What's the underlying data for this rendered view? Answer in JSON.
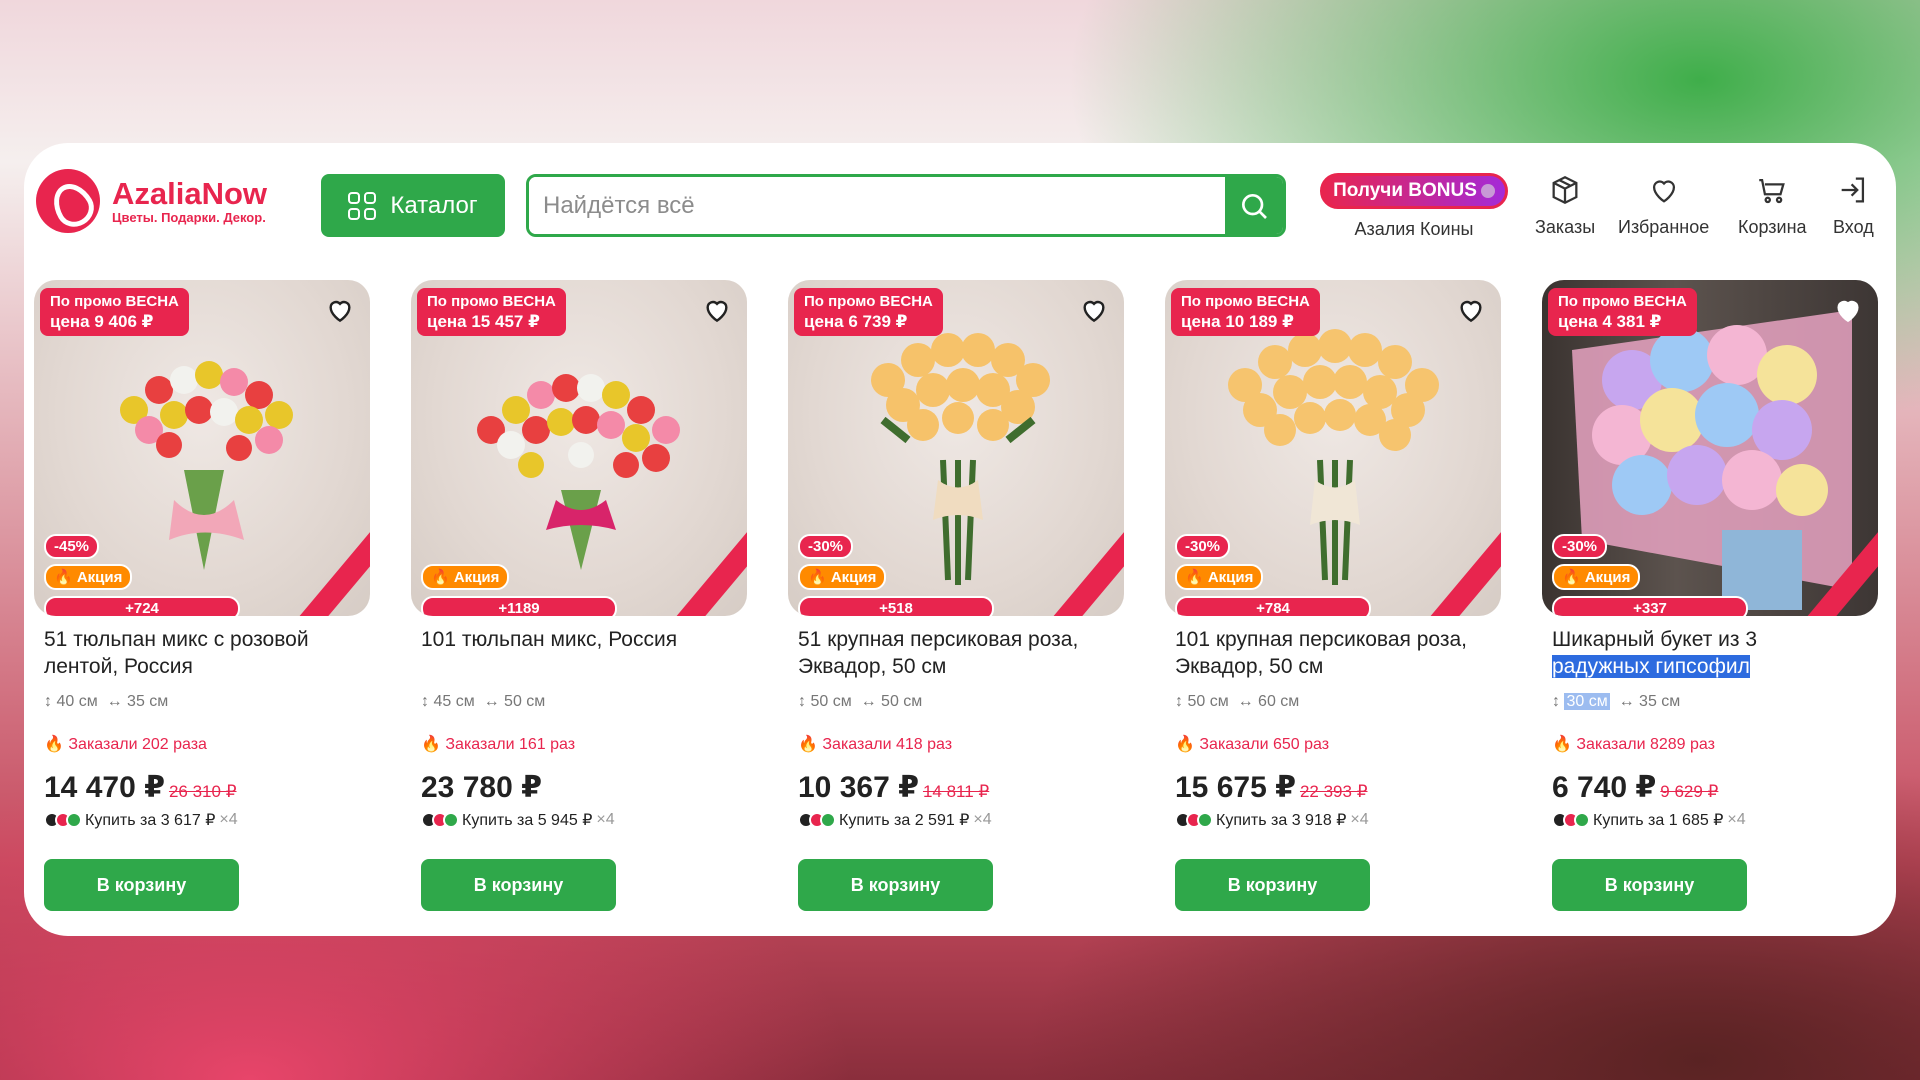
{
  "header": {
    "logo_title": "AzaliaNow",
    "logo_subtitle": "Цветы. Подарки. Декор.",
    "catalog_label": "Каталог",
    "search_placeholder": "Найдётся всё",
    "bonus_pill": "Получи BONUS",
    "bonus_label": "Азалия Коины",
    "nav": [
      {
        "label": "Заказы",
        "icon": "box-icon"
      },
      {
        "label": "Избранное",
        "icon": "heart-icon"
      },
      {
        "label": "Корзина",
        "icon": "cart-icon"
      },
      {
        "label": "Вход",
        "icon": "login-icon"
      }
    ]
  },
  "colors": {
    "accent_green": "#2fa84a",
    "brand_red": "#e8254e",
    "promo_orange": "#ff8a00"
  },
  "products": [
    {
      "promo_line1": "По промо ВЕСНА",
      "promo_line2": "цена 9 406 ₽",
      "discount": "-45%",
      "action": "🔥 Акция",
      "bonus": "+724",
      "title": "51 тюльпан микс с розовой лентой, Россия",
      "height": "40 см",
      "width": "35 см",
      "ordered": "Заказали 202 раза",
      "price": "14 470 ₽",
      "old_price": "26 310 ₽",
      "split": "Купить за 3 617 ₽",
      "split_mult": "×4",
      "button": "В корзину"
    },
    {
      "promo_line1": "По промо ВЕСНА",
      "promo_line2": "цена 15 457 ₽",
      "discount": "",
      "action": "🔥 Акция",
      "bonus": "+1189",
      "title": "101 тюльпан микс, Россия",
      "height": "45 см",
      "width": "50 см",
      "ordered": "Заказали 161 раз",
      "price": "23 780 ₽",
      "old_price": "",
      "split": "Купить за 5 945 ₽",
      "split_mult": "×4",
      "button": "В корзину"
    },
    {
      "promo_line1": "По промо ВЕСНА",
      "promo_line2": "цена 6 739 ₽",
      "discount": "-30%",
      "action": "🔥 Акция",
      "bonus": "+518",
      "title": "51 крупная персиковая роза, Эквадор, 50 см",
      "height": "50 см",
      "width": "50 см",
      "ordered": "Заказали 418 раз",
      "price": "10 367 ₽",
      "old_price": "14 811 ₽",
      "split": "Купить за 2 591 ₽",
      "split_mult": "×4",
      "button": "В корзину"
    },
    {
      "promo_line1": "По промо ВЕСНА",
      "promo_line2": "цена 10 189 ₽",
      "discount": "-30%",
      "action": "🔥 Акция",
      "bonus": "+784",
      "title": "101 крупная персиковая роза, Эквадор, 50 см",
      "height": "50 см",
      "width": "60 см",
      "ordered": "Заказали 650 раз",
      "price": "15 675 ₽",
      "old_price": "22 393 ₽",
      "split": "Купить за 3 918 ₽",
      "split_mult": "×4",
      "button": "В корзину"
    },
    {
      "promo_line1": "По промо ВЕСНА",
      "promo_line2": "цена 4 381 ₽",
      "discount": "-30%",
      "action": "🔥 Акция",
      "bonus": "+337",
      "title_plain": "Шикарный букет из 3",
      "title_highlight": "радужных гипсофил",
      "height": "30 см",
      "width": "35 см",
      "ordered": "Заказали 8289 раз",
      "price": "6 740 ₽",
      "old_price": "9 629 ₽",
      "split": "Купить за 1 685 ₽",
      "split_mult": "×4",
      "button": "В корзину"
    }
  ]
}
